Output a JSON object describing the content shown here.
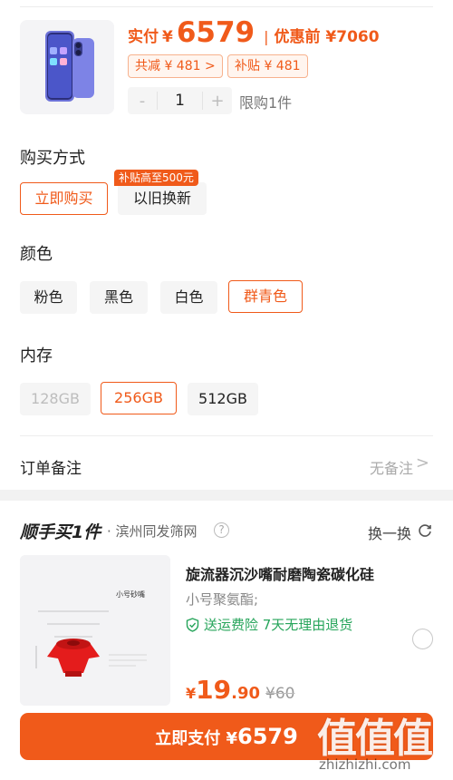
{
  "header": {
    "paid_label": "实付",
    "currency": "¥",
    "paid_amount": "6579",
    "separator": "|",
    "before_discount": "优惠前 ¥7060",
    "discount_tag": "共减 ¥ 481 >",
    "subsidy_tag": "补贴 ¥ 481",
    "quantity": "1",
    "minus": "-",
    "plus": "+",
    "limit": "限购1件"
  },
  "purchase": {
    "title": "购买方式",
    "options": [
      "立即购买",
      "以旧换新"
    ],
    "selected": 0,
    "bubble": "补贴高至500元"
  },
  "color": {
    "title": "颜色",
    "options": [
      "粉色",
      "黑色",
      "白色",
      "群青色"
    ],
    "selected": 3
  },
  "storage": {
    "title": "内存",
    "options": [
      "128GB",
      "256GB",
      "512GB"
    ],
    "selected": 1,
    "disabled": [
      0
    ]
  },
  "note": {
    "label": "订单备注",
    "value": "无备注",
    "chevron": ">"
  },
  "addon": {
    "logo": "顺手买1件",
    "shop": "· 滨州同发筛网",
    "help": "?",
    "swap_label": "换一换",
    "item_title": "旋流器沉沙嘴耐磨陶瓷碳化硅",
    "item_spec": "小号聚氨酯;",
    "guarantee": "送运费险 7天无理由退货",
    "price_yen": "¥",
    "price_int": "19",
    "price_dec": ".90",
    "price_old": "¥60",
    "image_label": "小号砂嘴"
  },
  "pay": {
    "label": "立即支付 ¥",
    "amount": "6579"
  },
  "watermark": {
    "logo": "值值值",
    "url": "zhizhizhi.com"
  },
  "colors": {
    "accent": "#f05a1a",
    "green": "#27a55b"
  }
}
